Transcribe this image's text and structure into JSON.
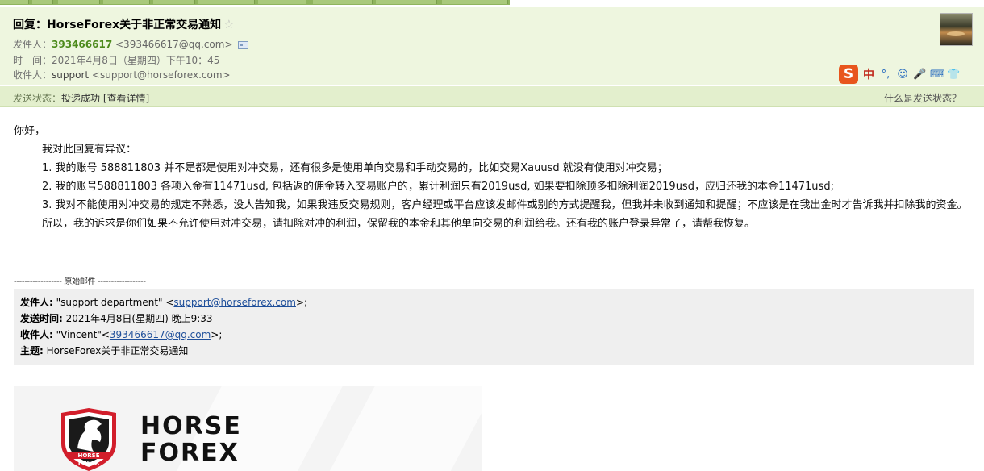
{
  "email": {
    "subject": "回复：HorseForex关于非正常交易通知",
    "star": "☆",
    "from_label": "发件人：",
    "from_name": "393466617",
    "from_address": "<393466617@qq.com>",
    "time_label": "时　间：",
    "time_value": "2021年4月8日（星期四）下午10：45",
    "to_label": "收件人：",
    "to_name": "support",
    "to_address": "<support@horseforex.com>"
  },
  "status": {
    "label": "发送状态：",
    "value": "投递成功",
    "detail_link": "[查看详情]",
    "help_link": "什么是发送状态？"
  },
  "ime": {
    "logo": "S",
    "items": [
      "中",
      "°,",
      "☺",
      "🎤",
      "⌨",
      "👕"
    ]
  },
  "body": {
    "greeting": "你好，",
    "intro": "我对此回复有异议：",
    "point1": "1. 我的账号 588811803 并不是都是使用对冲交易，还有很多是使用单向交易和手动交易的，比如交易Xauusd 就没有使用对冲交易；",
    "point2": "2. 我的账号588811803 各项入金有11471usd, 包括返的佣金转入交易账户的，累计利润只有2019usd, 如果要扣除顶多扣除利润2019usd，应归还我的本金11471usd;",
    "point3": "3. 我对不能使用对冲交易的规定不熟悉，没人告知我，如果我违反交易规则，客户经理或平台应该发邮件或别的方式提醒我，但我并未收到通知和提醒；不应该是在我出金时才告诉我并扣除我的资金。",
    "conclusion": "所以，我的诉求是你们如果不允许使用对冲交易，请扣除对冲的利润，保留我的本金和其他单向交易的利润给我。还有我的账户登录异常了，请帮我恢复。"
  },
  "original": {
    "divider": "------------------ 原始邮件 ------------------",
    "from_label": "发件人:",
    "from_name": " \"support department\" <",
    "from_email": "support@horseforex.com",
    "from_tail": ">;",
    "sent_label": "发送时间:",
    "sent_value": " 2021年4月8日(星期四) 晚上9:33",
    "to_label": "收件人:",
    "to_name": " \"Vincent\"<",
    "to_email": "393466617@qq.com",
    "to_tail": ">;",
    "subject_label": "主题:",
    "subject_value": " HorseForex关于非正常交易通知"
  },
  "banner": {
    "logo_line1_a": "H",
    "logo_line1_b": "ORSE",
    "logo_line2_a": "F",
    "logo_line2_b": "OREX",
    "shield_text1": "HORSE",
    "shield_text2": "FOREX"
  },
  "colors": {
    "header_bg": "#eef6df",
    "status_bg": "#e3efcd",
    "sender_green": "#4c8a1b",
    "brand_red": "#d21e2b",
    "ime_orange": "#e8551d"
  }
}
